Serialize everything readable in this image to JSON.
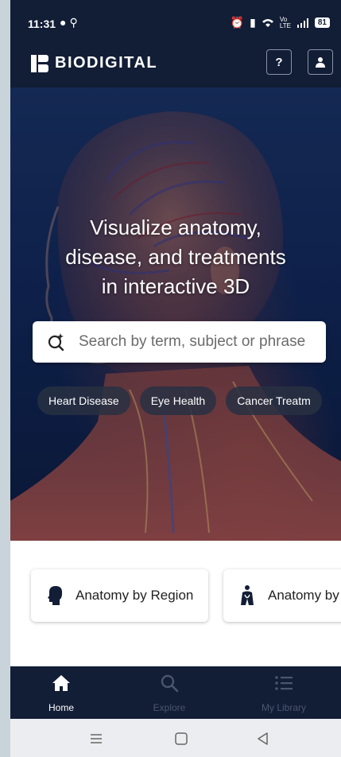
{
  "status_bar": {
    "time": "11:31",
    "left_icons": [
      "message-icon",
      "accessibility-icon"
    ],
    "right_icons": [
      "alarm-icon",
      "vibrate-icon",
      "wifi-icon",
      "volte-icon",
      "signal-icon"
    ],
    "volte_text": "Vo LTE",
    "battery": "81"
  },
  "header": {
    "brand": "BIODIGITAL",
    "help_label": "?",
    "account_icon": "person-icon"
  },
  "hero": {
    "headline_lines": [
      "Visualize anatomy,",
      "disease, and treatments",
      "in interactive 3D"
    ],
    "search_placeholder": "Search by term, subject or phrase",
    "chips": [
      "Heart Disease",
      "Eye Health",
      "Cancer Treatm"
    ]
  },
  "categories": [
    {
      "label": "Anatomy by Region",
      "icon": "head-silhouette-icon"
    },
    {
      "label": "Anatomy by",
      "icon": "body-systems-icon"
    }
  ],
  "bottom_nav": [
    {
      "label": "Home",
      "icon": "home-icon",
      "active": true
    },
    {
      "label": "Explore",
      "icon": "search-icon",
      "active": false
    },
    {
      "label": "My Library",
      "icon": "list-icon",
      "active": false
    }
  ],
  "system_nav": [
    "menu-icon",
    "home-square-icon",
    "back-triangle-icon"
  ],
  "colors": {
    "chrome": "#121d36",
    "hero_blue": "#0f2553",
    "inactive_nav": "#4b5570",
    "card_bg": "#ffffff"
  }
}
